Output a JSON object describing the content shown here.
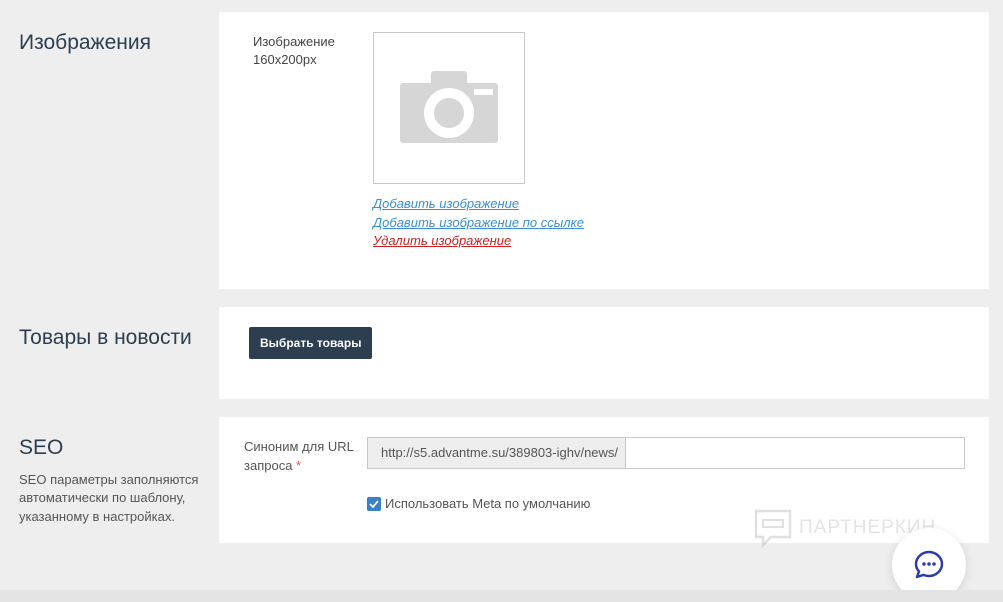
{
  "images_section": {
    "title": "Изображения",
    "label_line1": "Изображение",
    "label_line2": "160x200px",
    "placeholder_icon": "camera-icon",
    "links": {
      "add": "Добавить изображение",
      "add_by_url": "Добавить изображение по ссылке",
      "delete": "Удалить изображение"
    }
  },
  "goods_section": {
    "title": "Товары в новости",
    "select_button": "Выбрать товары"
  },
  "seo_section": {
    "title": "SEO",
    "description": "SEO параметры заполняются автоматически по шаблону, указанному в настройках.",
    "url_label": "Синоним для URL запроса",
    "required_mark": "*",
    "url_prefix": "http://s5.advantme.su/389803-ighv/news/",
    "url_value": "",
    "use_meta_label": "Использовать Meta по умолчанию",
    "use_meta_checked": true
  },
  "watermark": {
    "text": "ПАРТНЕРКИН"
  },
  "chat": {
    "icon": "chat-bubble-icon"
  },
  "colors": {
    "accent_blue": "#3b8fd0",
    "danger_red": "#cc2222",
    "dark_button": "#2c3e50",
    "checkbox_blue": "#3b7fc4"
  }
}
